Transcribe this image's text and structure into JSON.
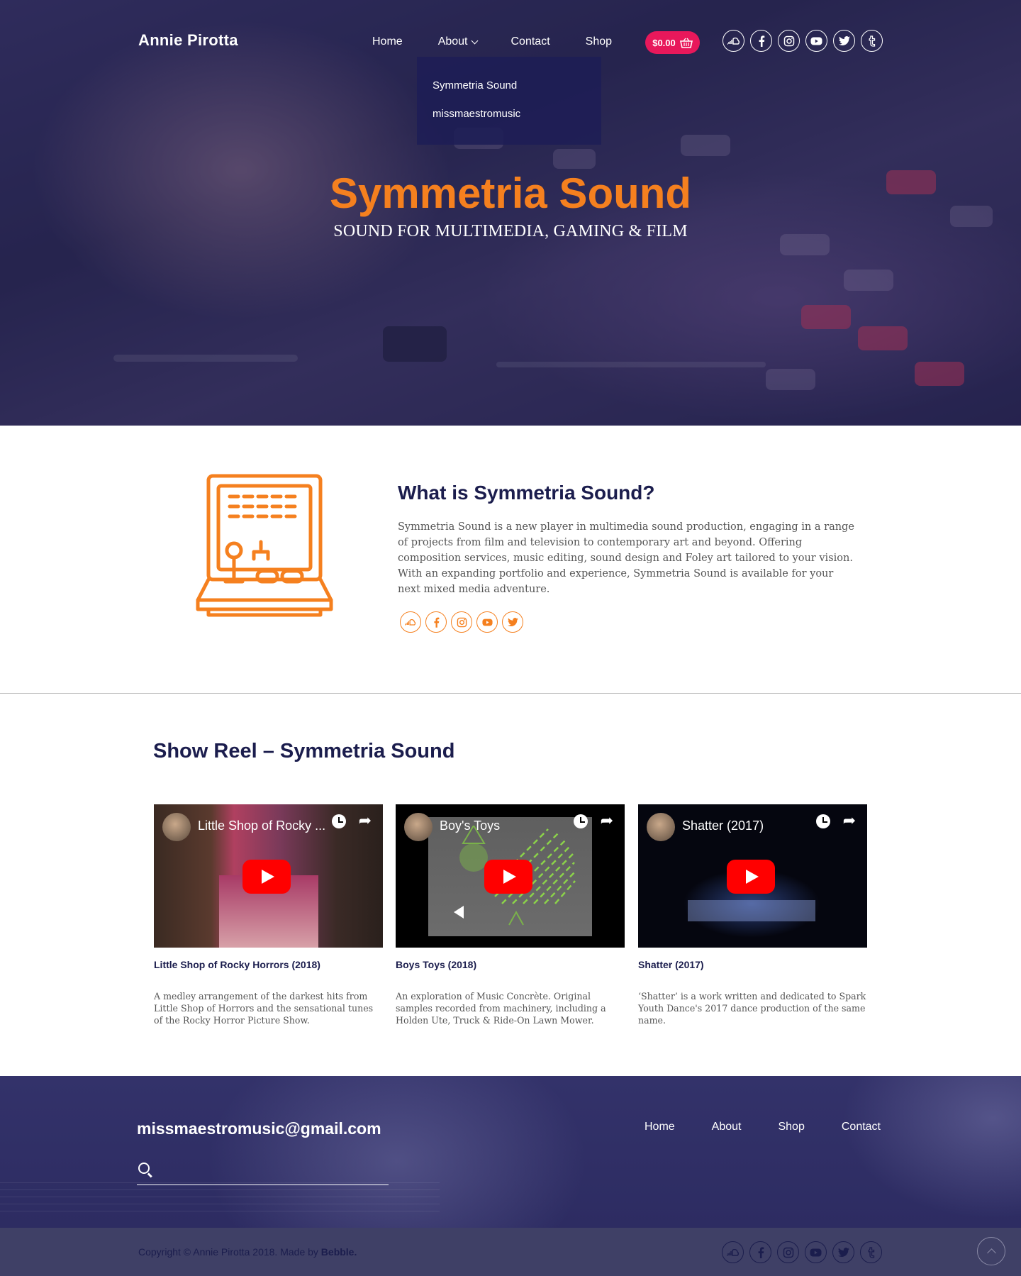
{
  "header": {
    "logo": "Annie Pirotta",
    "nav": [
      {
        "label": "Home"
      },
      {
        "label": "About"
      },
      {
        "label": "Contact"
      },
      {
        "label": "Shop"
      }
    ],
    "cart_total": "$0.00",
    "social_icons": [
      "soundcloud-icon",
      "facebook-icon",
      "instagram-icon",
      "youtube-icon",
      "twitter-icon",
      "tumblr-icon"
    ],
    "dropdown": [
      "Symmetria Sound",
      "missmaestromusic"
    ]
  },
  "hero": {
    "title": "Symmetria Sound",
    "subtitle": "SOUND FOR MULTIMEDIA, GAMING & FILM"
  },
  "about": {
    "title": "What is Symmetria Sound?",
    "text": "Symmetria Sound is a new player in multimedia sound production, engaging in a range of projects from film and television to contemporary art and beyond. Offering composition services, music editing, sound design and Foley art tailored to your vision. With an expanding portfolio and experience, Symmetria Sound is available for your next mixed media adventure.",
    "social_icons": [
      "soundcloud-icon",
      "facebook-icon",
      "instagram-icon",
      "youtube-icon",
      "twitter-icon"
    ]
  },
  "reel": {
    "title": "Show Reel – Symmetria Sound",
    "videos": [
      {
        "video_title": "Little Shop of Rocky ...",
        "title": "Little Shop of Rocky Horrors (2018)",
        "desc": "A medley arrangement of the darkest hits from Little Shop of Horrors and the sensational tunes of the Rocky Horror Picture Show."
      },
      {
        "video_title": "Boy's Toys",
        "title": "Boys Toys (2018)",
        "desc": "An exploration of Music Concrète. Original samples recorded from machinery, including a Holden Ute, Truck & Ride-On Lawn Mower."
      },
      {
        "video_title": "Shatter (2017)",
        "title": "Shatter (2017)",
        "desc": "‘Shatter’ is a work written and dedicated to Spark Youth Dance's 2017 dance production of the same name."
      }
    ]
  },
  "footer": {
    "email": "missmaestromusic@gmail.com",
    "nav": [
      "Home",
      "About",
      "Shop",
      "Contact"
    ],
    "copyright_prefix": "Copyright © Annie Pirotta 2018. Made by ",
    "copyright_brand": "Bebble."
  },
  "colors": {
    "accent_orange": "#f5801f",
    "cart_pink": "#e8185b",
    "navy": "#1b1d4d"
  }
}
